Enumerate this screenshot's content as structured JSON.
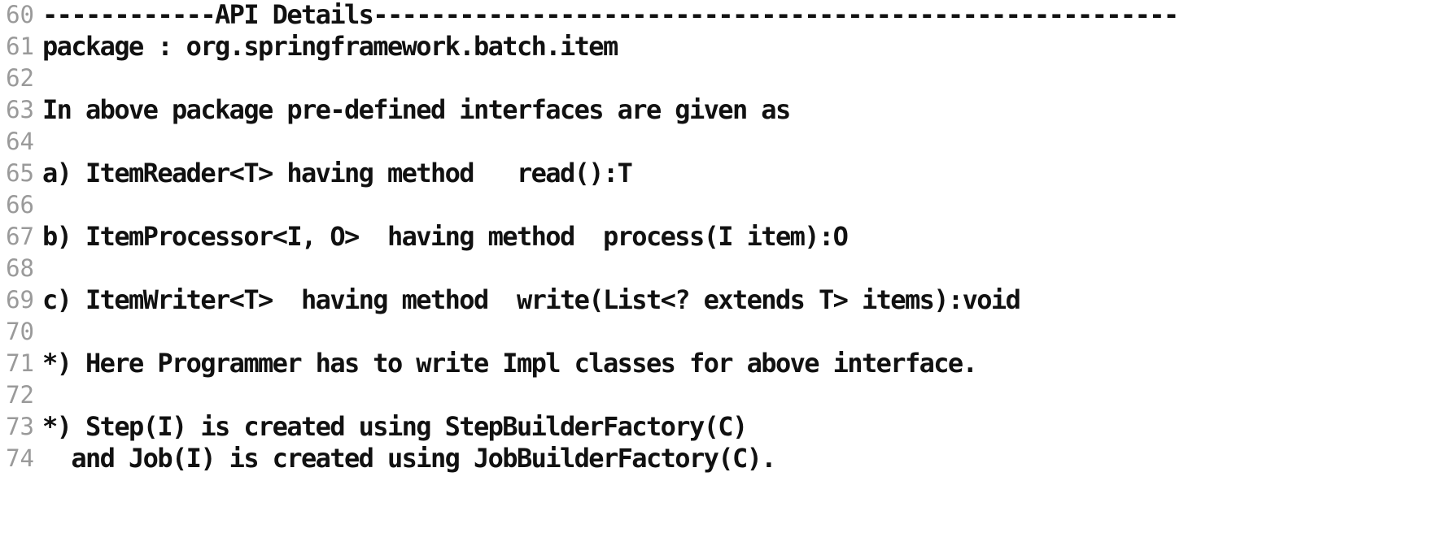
{
  "editor": {
    "lines": [
      {
        "number": "60",
        "text": "------------API Details--------------------------------------------------------"
      },
      {
        "number": "61",
        "text": "package : org.springframework.batch.item"
      },
      {
        "number": "62",
        "text": ""
      },
      {
        "number": "63",
        "text": "In above package pre-defined interfaces are given as"
      },
      {
        "number": "64",
        "text": ""
      },
      {
        "number": "65",
        "text": "a) ItemReader<T> having method   read():T"
      },
      {
        "number": "66",
        "text": ""
      },
      {
        "number": "67",
        "text": "b) ItemProcessor<I, O>  having method  process(I item):O"
      },
      {
        "number": "68",
        "text": ""
      },
      {
        "number": "69",
        "text": "c) ItemWriter<T>  having method  write(List<? extends T> items):void"
      },
      {
        "number": "70",
        "text": ""
      },
      {
        "number": "71",
        "text": "*) Here Programmer has to write Impl classes for above interface."
      },
      {
        "number": "72",
        "text": ""
      },
      {
        "number": "73",
        "text": "*) Step(I) is created using StepBuilderFactory(C)"
      },
      {
        "number": "74",
        "text": "  and Job(I) is created using JobBuilderFactory(C)."
      }
    ]
  }
}
